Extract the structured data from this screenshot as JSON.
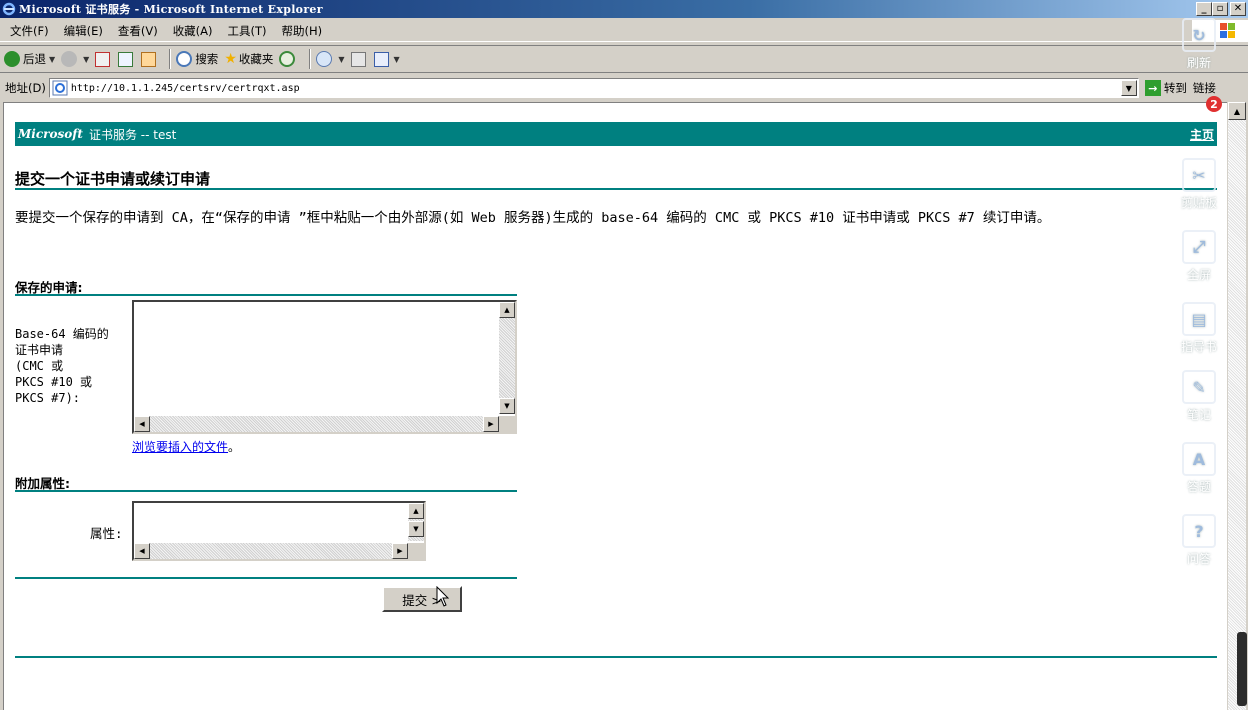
{
  "window": {
    "title": "Microsoft 证书服务 - Microsoft Internet Explorer",
    "controls": {
      "minimize": "_",
      "maximize": "▫",
      "close": "✕"
    }
  },
  "menu": [
    "文件(F)",
    "编辑(E)",
    "查看(V)",
    "收藏(A)",
    "工具(T)",
    "帮助(H)"
  ],
  "toolbar": {
    "back": "后退",
    "search": "搜索",
    "favorites": "收藏夹"
  },
  "address": {
    "label": "地址(D)",
    "url": "http://10.1.1.245/certsrv/certrqxt.asp",
    "go": "转到",
    "links": "链接"
  },
  "page": {
    "banner_brand": "Microsoft",
    "banner_service": "证书服务 -- test",
    "home_link": "主页",
    "title": "提交一个证书申请或续订申请",
    "description": "要提交一个保存的申请到 CA，在“保存的申请 ”框中粘贴一个由外部源(如 Web 服务器)生成的 base-64 编码的 CMC 或 PKCS #10 证书申请或 PKCS #7 续订申请。",
    "saved_request_heading": "保存的申请:",
    "saved_request_label": "Base-64 编码的证书申请 (CMC 或 PKCS #10 或 PKCS #7):",
    "saved_request_label_lines": [
      "Base-64 编码的",
      "证书申请",
      "(CMC 或",
      "PKCS #10 或",
      "PKCS #7):"
    ],
    "browse_link": "浏览要插入的文件",
    "browse_suffix": "。",
    "extra_attrs_heading": "附加属性:",
    "attributes_label": "属性:",
    "submit_button": "提交 >"
  },
  "dock": {
    "items": [
      "刷新",
      "剪贴板",
      "全屏",
      "指导书",
      "笔记",
      "答题",
      "问答"
    ],
    "badge": "2"
  }
}
